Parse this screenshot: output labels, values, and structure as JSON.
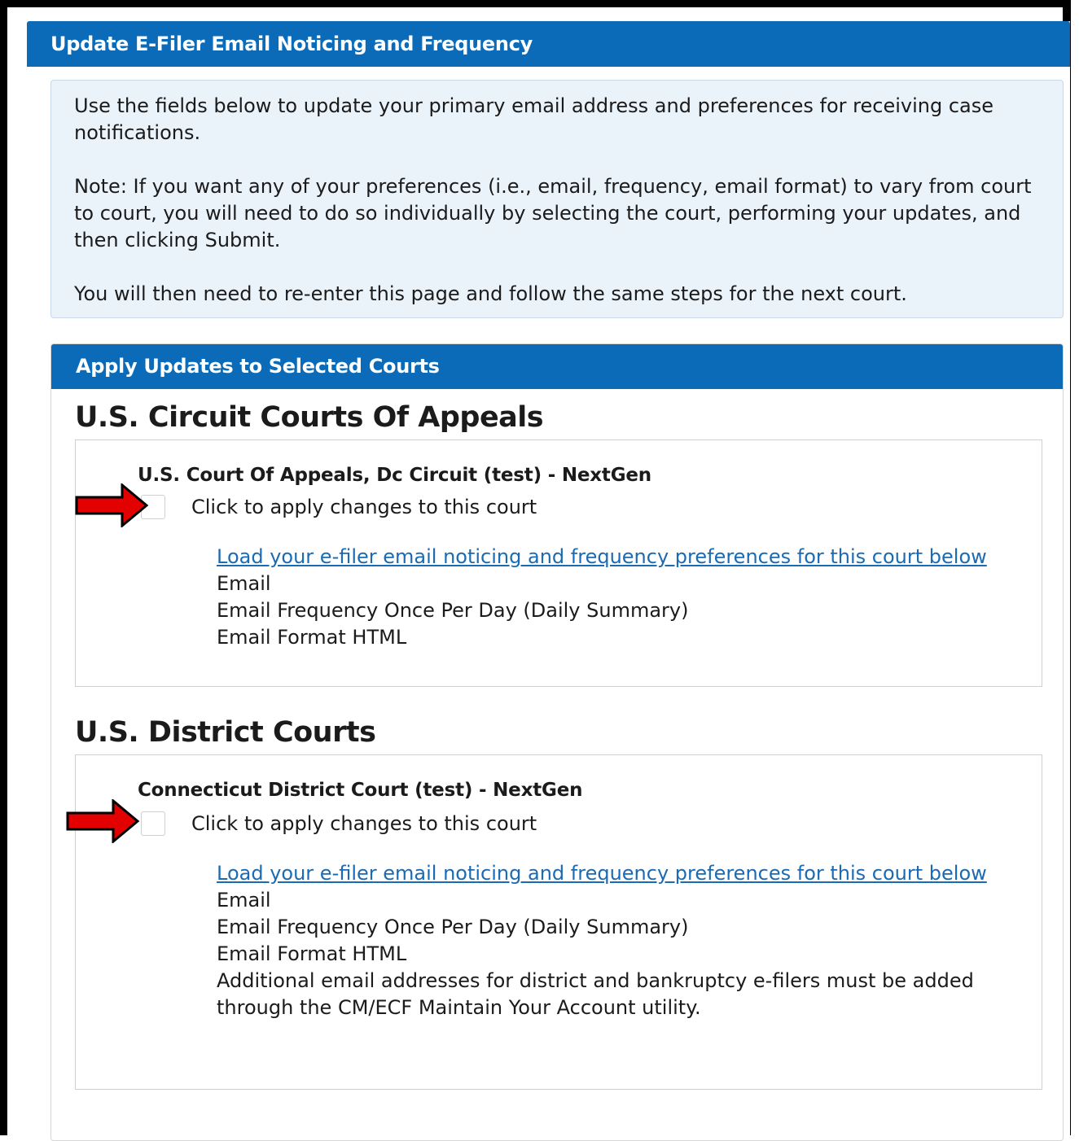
{
  "header": {
    "title": "Update E-Filer Email Noticing and Frequency"
  },
  "info": {
    "para1": "Use the fields below to update your primary email address and preferences for receiving case notifications.",
    "para2": "Note: If you want any of your preferences (i.e., email, frequency, email format) to vary from court to court, you will need to do so individually by selecting the court, performing your updates, and then clicking Submit.",
    "para3": "You will then need to re-enter this page and follow the same steps for the next court."
  },
  "courts_panel": {
    "title": "Apply Updates to Selected Courts"
  },
  "sections": [
    {
      "title": "U.S. Circuit Courts Of Appeals",
      "court": {
        "name": "U.S. Court Of Appeals, Dc Circuit (test) - NextGen",
        "checkbox_label": "Click to apply changes to this court",
        "checked": false,
        "load_link": "Load your e-filer email noticing and frequency preferences for this court below",
        "email_label": "Email",
        "frequency": "Email Frequency Once Per Day (Daily Summary)",
        "format": "Email Format HTML"
      }
    },
    {
      "title": "U.S. District Courts",
      "court": {
        "name": "Connecticut District Court (test) - NextGen",
        "checkbox_label": "Click to apply changes to this court",
        "checked": false,
        "load_link": "Load your e-filer email noticing and frequency preferences for this court below",
        "email_label": "Email",
        "frequency": "Email Frequency Once Per Day (Daily Summary)",
        "format": "Email Format HTML",
        "note": "Additional email addresses for district and bankruptcy e-filers must be added through the CM/ECF Maintain Your Account utility."
      }
    }
  ],
  "annotations": {
    "arrow_color": "#e30000",
    "arrow_icon": "red-arrow-right-icon"
  },
  "colors": {
    "header_blue": "#0b6bb8",
    "info_bg": "#eaf2fa",
    "link": "#1a6bb3"
  }
}
